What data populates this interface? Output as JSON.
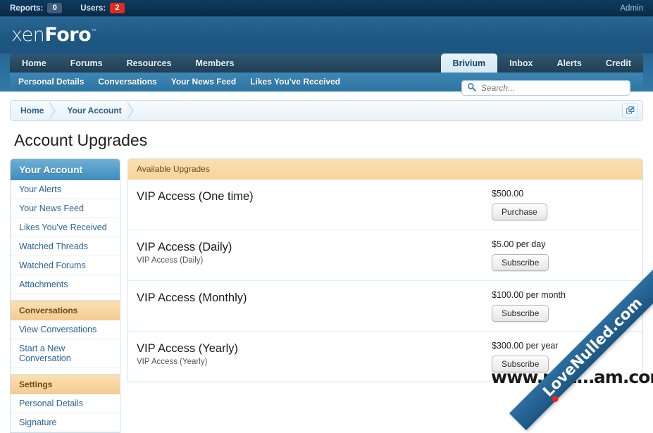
{
  "topbar": {
    "reports_label": "Reports:",
    "reports_count": "0",
    "users_label": "Users:",
    "users_count": "2",
    "admin_label": "Admin"
  },
  "logo": {
    "part1": "xen",
    "part2": "Foro",
    "tm": "™"
  },
  "nav": {
    "primary": [
      {
        "label": "Home",
        "selected": false
      },
      {
        "label": "Forums",
        "selected": false
      },
      {
        "label": "Resources",
        "selected": false
      },
      {
        "label": "Members",
        "selected": false
      }
    ],
    "right": [
      {
        "label": "Brivium",
        "selected": true
      },
      {
        "label": "Inbox",
        "selected": false
      },
      {
        "label": "Alerts",
        "selected": false
      },
      {
        "label": "Credit",
        "selected": false
      }
    ],
    "secondary": [
      {
        "label": "Personal Details"
      },
      {
        "label": "Conversations"
      },
      {
        "label": "Your News Feed"
      },
      {
        "label": "Likes You've Received"
      }
    ]
  },
  "search": {
    "placeholder": "Search...",
    "value": "",
    "icon": "search-icon"
  },
  "breadcrumb": {
    "items": [
      {
        "label": "Home"
      },
      {
        "label": "Your Account"
      }
    ],
    "open_icon": "open-in-new-window-icon"
  },
  "page": {
    "title": "Account Upgrades"
  },
  "sidebar": {
    "sections": [
      {
        "header": "Your Account",
        "style": "primary",
        "items": [
          {
            "label": "Your Alerts"
          },
          {
            "label": "Your News Feed"
          },
          {
            "label": "Likes You've Received"
          },
          {
            "label": "Watched Threads"
          },
          {
            "label": "Watched Forums"
          },
          {
            "label": "Attachments"
          }
        ]
      },
      {
        "header": "Conversations",
        "style": "sub",
        "items": [
          {
            "label": "View Conversations"
          },
          {
            "label": "Start a New Conversation"
          }
        ]
      },
      {
        "header": "Settings",
        "style": "sub",
        "items": [
          {
            "label": "Personal Details"
          },
          {
            "label": "Signature"
          }
        ]
      }
    ]
  },
  "main": {
    "panel_header": "Available Upgrades",
    "upgrades": [
      {
        "title": "VIP Access (One time)",
        "description": "",
        "price": "$500.00",
        "action": "Purchase"
      },
      {
        "title": "VIP Access (Daily)",
        "description": "VIP Access (Daily)",
        "price": "$5.00 per day",
        "action": "Subscribe"
      },
      {
        "title": "VIP Access (Monthly)",
        "description": "",
        "price": "$100.00 per month",
        "action": "Subscribe"
      },
      {
        "title": "VIP Access (Yearly)",
        "description": "VIP Access (Yearly)",
        "price": "$300.00 per year",
        "action": "Subscribe"
      }
    ]
  },
  "watermarks": {
    "horizontal": "www.null…am.com",
    "ribbon": "LoveNulled.com"
  },
  "colors": {
    "brand_blue": "#1b5480",
    "accent_orange": "#f5cc90",
    "badge_red": "#e02b20",
    "link_blue": "#2a6496"
  }
}
